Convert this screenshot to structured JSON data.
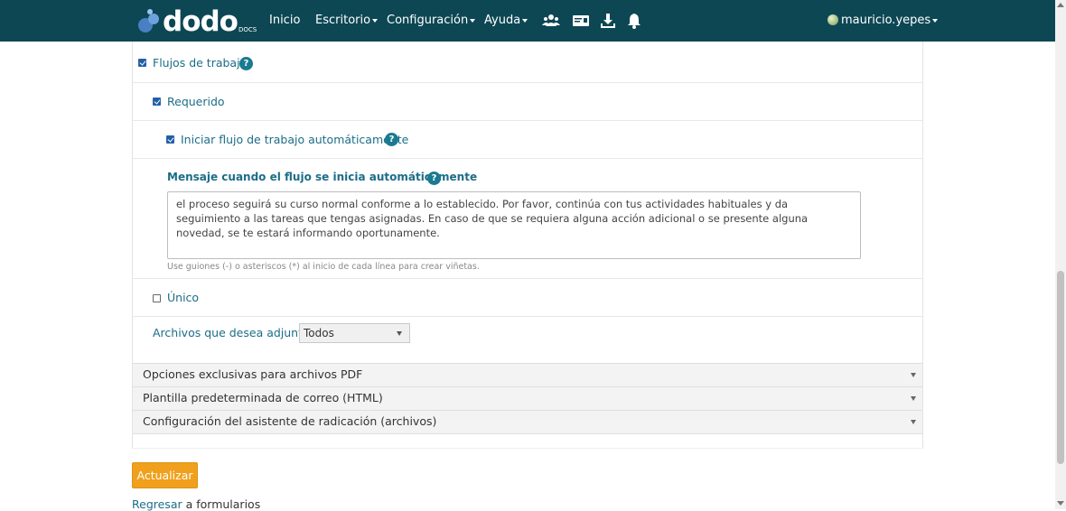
{
  "navbar": {
    "logo_text": "dodo",
    "logo_sub": "DOCS",
    "items": [
      {
        "label": "Inicio",
        "dropdown": false
      },
      {
        "label": "Escritorio",
        "dropdown": true
      },
      {
        "label": "Configuración",
        "dropdown": true
      },
      {
        "label": "Ayuda",
        "dropdown": true
      }
    ],
    "icons": [
      "users-icon",
      "id-card-icon",
      "download-icon",
      "bell-icon"
    ],
    "user": "mauricio.yepes"
  },
  "form": {
    "workflows_label": "Flujos de trabajo",
    "required_label": "Requerido",
    "auto_start_label": "Iniciar flujo de trabajo automáticamente",
    "message_heading": "Mensaje cuando el flujo se inicia automáticamente",
    "message_value": "el proceso seguirá su curso normal conforme a lo establecido. Por favor, continúa con tus actividades habituales y da seguimiento a las tareas que tengas asignadas. En caso de que se requiera alguna acción adicional o se presente alguna novedad, se te estará informando oportunamente.",
    "message_hint": "Use guiones (-) o asteriscos (*) al inicio de cada línea para crear viñetas.",
    "unique_label": "Único",
    "attachments_label": "Archivos que desea adjuntar",
    "attachments_value": "Todos",
    "help_symbol": "?",
    "checkboxes": {
      "workflows": true,
      "required": true,
      "auto_start": true,
      "unique": false
    }
  },
  "accordions": [
    "Opciones exclusivas para archivos PDF",
    "Plantilla predeterminada de correo (HTML)",
    "Configuración del asistente de radicación (archivos)"
  ],
  "actions": {
    "update_button": "Actualizar",
    "back_link": "Regresar",
    "back_suffix": " a formularios"
  },
  "colors": {
    "navbar": "#0d4754",
    "link": "#1c6d88",
    "primary_button": "#f0a01c"
  }
}
